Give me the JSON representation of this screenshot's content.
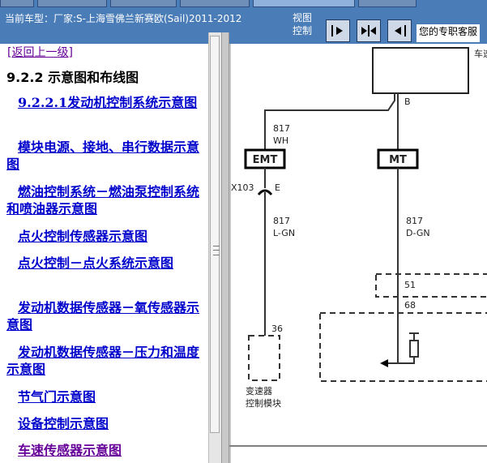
{
  "header": {
    "current_car": "当前车型：厂家:S-上海雪佛兰新赛欧(Sail)2011-2012",
    "view_control": "视图控制",
    "service": "您的专职客服"
  },
  "nav": {
    "back_link": "[返回上一级]",
    "section_title": "9.2.2 示意图和布线图",
    "links": [
      "9.2.2.1发动机控制系统示意图",
      "模块电源、接地、串行数据示意图",
      "燃油控制系统－燃油泵控制系统和喷油器示意图",
      "点火控制传感器示意图",
      "点火控制－点火系统示意图",
      "发动机数据传感器－氧传感器示意图",
      "发动机数据传感器－压力和温度示意图",
      "节气门示意图",
      "设备控制示意图",
      "车速传感器示意图"
    ]
  },
  "diagram": {
    "top_module_label": "车速传感器",
    "top_pin": "B",
    "left_wire_num": "817",
    "left_wire_color": "WH",
    "emt": "EMT",
    "mt": "MT",
    "connector": "X103",
    "connector_pin": "E",
    "left_wire_num2": "817",
    "left_wire_color2": "L-GN",
    "right_wire_num": "817",
    "right_wire_color": "D-GN",
    "pin_51": "51",
    "pin_68": "68",
    "pin_36": "36",
    "module_label_line1": "变速器",
    "module_label_line2": "控制模块"
  }
}
